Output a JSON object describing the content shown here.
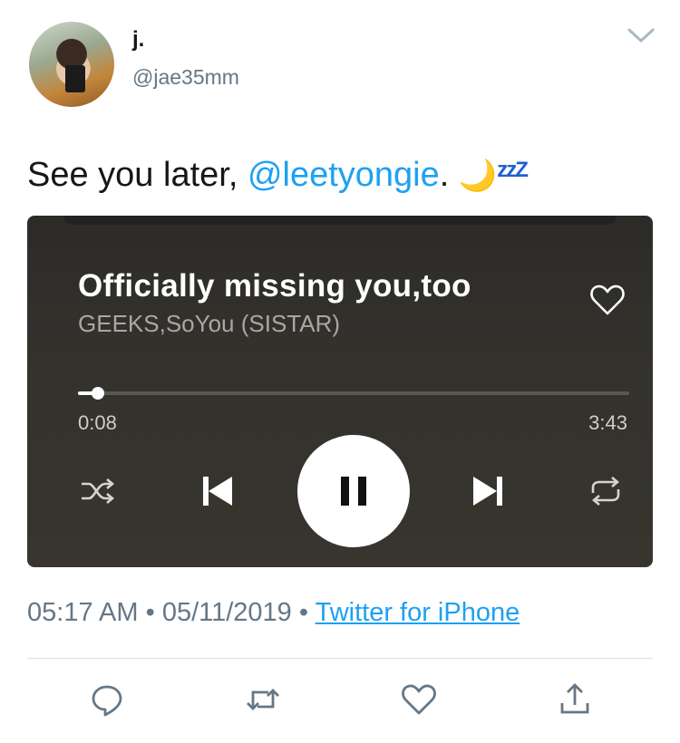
{
  "tweet": {
    "author_name": "j.",
    "author_handle": "@jae35mm",
    "text_prefix": "See you later, ",
    "mention": "@leetyongie",
    "text_suffix": ". ",
    "emoji_moon": "🌙",
    "emoji_zzz": "zzZ",
    "timestamp": "05:17 AM",
    "separator": "•",
    "date": "05/11/2019",
    "source": "Twitter for iPhone"
  },
  "player": {
    "song_title": "Officially missing you,too",
    "artist": "GEEKS,SoYou (SISTAR)",
    "elapsed": "0:08",
    "duration": "3:43",
    "progress_fraction": 0.036
  },
  "colors": {
    "link": "#1da1f2",
    "secondary_text": "#657786",
    "player_bg": "#33312c",
    "emoji_zzz": "#1f5fd1"
  },
  "icons": {
    "chevron": "chevron-down-icon",
    "heart": "heart-icon",
    "shuffle": "shuffle-icon",
    "previous": "skip-previous-icon",
    "pause": "pause-icon",
    "next": "skip-next-icon",
    "repeat": "repeat-icon",
    "reply": "reply-icon",
    "retweet": "retweet-icon",
    "like": "like-icon",
    "share": "share-icon"
  }
}
